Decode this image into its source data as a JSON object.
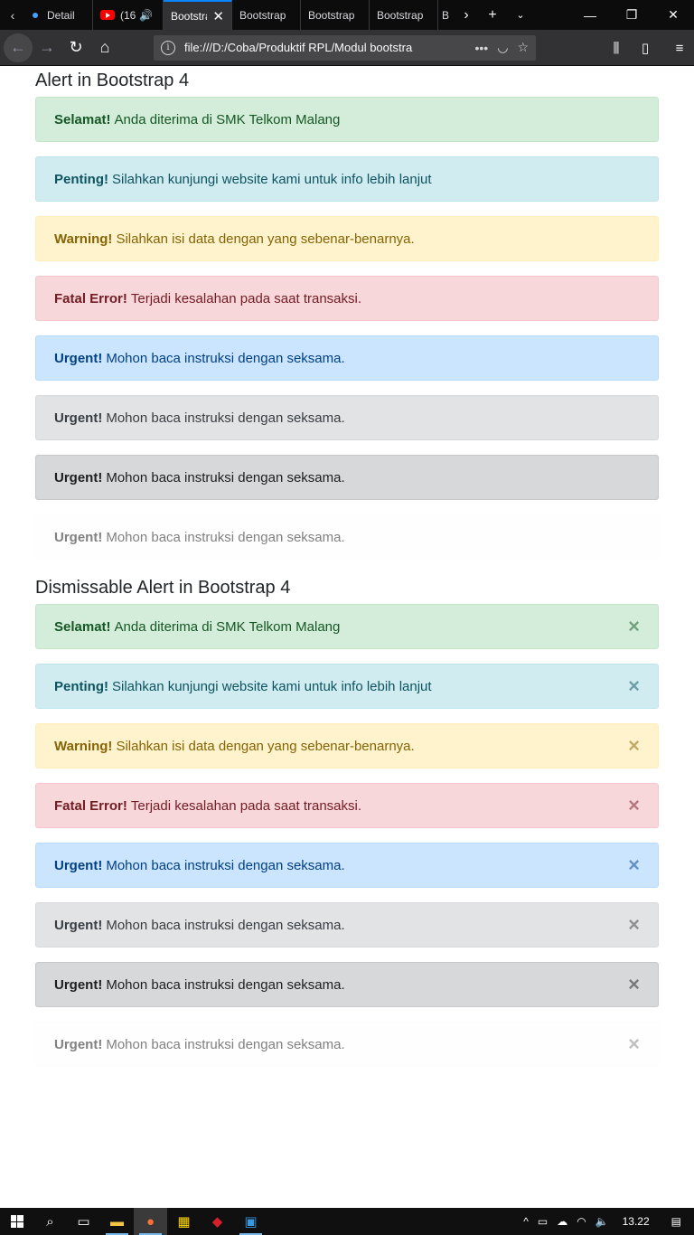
{
  "browser": {
    "tabs": [
      {
        "label": "Detail",
        "active": false
      },
      {
        "label": "(16",
        "active": false
      },
      {
        "label": "Bootstra",
        "active": true
      },
      {
        "label": "Bootstrap",
        "active": false
      },
      {
        "label": "Bootstrap",
        "active": false
      },
      {
        "label": "Bootstrap",
        "active": false
      },
      {
        "label": "B",
        "active": false
      }
    ],
    "url": "file:///D:/Coba/Produktif RPL/Modul bootstra"
  },
  "page": {
    "section1_title": "Alert in Bootstrap 4",
    "section2_title": "Dismissable Alert in Bootstrap 4",
    "alerts": [
      {
        "variant": "success",
        "strong": "Selamat!",
        "text": "Anda diterima di SMK Telkom Malang"
      },
      {
        "variant": "info",
        "strong": "Penting!",
        "text": "Silahkan kunjungi website kami untuk info lebih lanjut"
      },
      {
        "variant": "warning",
        "strong": "Warning!",
        "text": "Silahkan isi data dengan yang sebenar-benarnya."
      },
      {
        "variant": "danger",
        "strong": "Fatal Error!",
        "text": "Terjadi kesalahan pada saat transaksi."
      },
      {
        "variant": "primary",
        "strong": "Urgent!",
        "text": "Mohon baca instruksi dengan seksama."
      },
      {
        "variant": "secondary",
        "strong": "Urgent!",
        "text": "Mohon baca instruksi dengan seksama."
      },
      {
        "variant": "dark",
        "strong": "Urgent!",
        "text": "Mohon baca instruksi dengan seksama."
      },
      {
        "variant": "light",
        "strong": "Urgent!",
        "text": "Mohon baca instruksi dengan seksama."
      }
    ],
    "close_glyph": "×"
  },
  "taskbar": {
    "clock": "13.22"
  }
}
